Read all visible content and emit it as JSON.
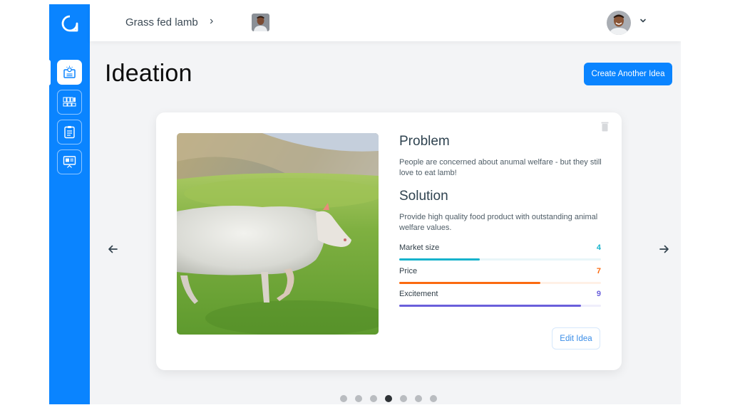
{
  "header": {
    "breadcrumb": "Grass fed lamb",
    "breadcrumb_separator": "›"
  },
  "sidebar": {
    "items": [
      {
        "name": "ideation",
        "icon": "lightbulb-card-icon",
        "active": true
      },
      {
        "name": "board",
        "icon": "grid-board-icon",
        "active": false
      },
      {
        "name": "clipboard",
        "icon": "clipboard-list-icon",
        "active": false
      },
      {
        "name": "presentation",
        "icon": "presentation-icon",
        "active": false
      }
    ]
  },
  "page": {
    "title": "Ideation",
    "create_button": "Create Another Idea"
  },
  "card": {
    "image_alt": "Sheep walking on green grass",
    "problem_title": "Problem",
    "problem_text": "People are concerned about anumal welfare - but they still love to eat lamb!",
    "solution_title": "Solution",
    "solution_text": "Provide high quality food product with outstanding animal welfare values.",
    "metrics": [
      {
        "label": "Market size",
        "value": "4",
        "fraction": 0.4,
        "color": "#16b3cc",
        "track": "#e8f6f9"
      },
      {
        "label": "Price",
        "value": "7",
        "fraction": 0.7,
        "color": "#fb6a10",
        "track": "#fff0e6"
      },
      {
        "label": "Excitement",
        "value": "9",
        "fraction": 0.9,
        "color": "#6a5fdb",
        "track": "#efeefb"
      }
    ],
    "edit_button": "Edit Idea"
  },
  "pagination": {
    "total": 7,
    "current_index": 3
  },
  "colors": {
    "brand": "#0a84ff"
  }
}
